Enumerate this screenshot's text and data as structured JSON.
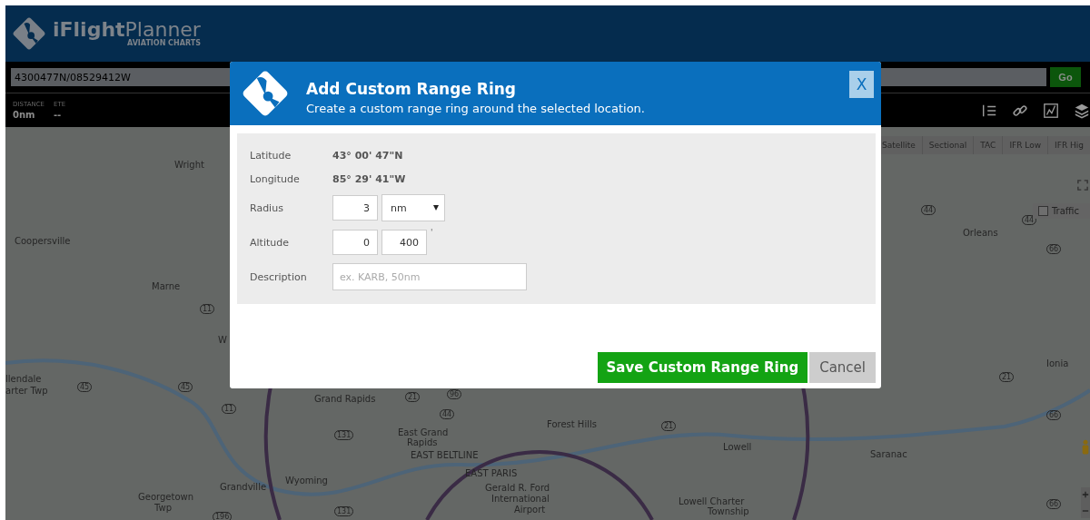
{
  "header": {
    "brand": "iFlight",
    "brand_light": "Planner",
    "tagline": "AVIATION CHARTS"
  },
  "search": {
    "value": "4300477N/08529412W",
    "button": "Go"
  },
  "stats": [
    {
      "label": "DISTANCE",
      "value": "0nm"
    },
    {
      "label": "ETE",
      "value": "--"
    }
  ],
  "map_types": [
    {
      "label": "Satellite",
      "selected": false
    },
    {
      "label": "Sectional",
      "selected": false
    },
    {
      "label": "TAC",
      "selected": false
    },
    {
      "label": "IFR Low",
      "selected": false
    },
    {
      "label": "IFR Hig",
      "selected": false
    }
  ],
  "traffic": {
    "label": "Traffic",
    "checked": false
  },
  "map_labels": [
    "Wright",
    "Coopersville",
    "Marne",
    "W",
    "llendale",
    "arter Twp",
    "Georgetown",
    "Twp",
    "Grandville",
    "Grand Rapids",
    "East Grand",
    "Rapids",
    "EAST BELTLINE",
    "EAST PARIS",
    "Wyoming",
    "Gerald R. Ford",
    "International",
    "Airport",
    "Forest Hills",
    "Lowell",
    "Lowell Charter",
    "Township",
    "Saranac",
    "Orleans",
    "Ionia"
  ],
  "road_shields": [
    "11",
    "45",
    "45",
    "11",
    "131",
    "131",
    "196",
    "96",
    "44",
    "21",
    "21",
    "21",
    "44",
    "44",
    "66",
    "66",
    "66"
  ],
  "dialog": {
    "title": "Add Custom Range Ring",
    "subtitle": "Create a custom range ring around the selected location.",
    "close": "X",
    "info": [
      {
        "label": "Latitude",
        "value": "43° 00' 47\"N"
      },
      {
        "label": "Longitude",
        "value": "85° 29' 41\"W"
      }
    ],
    "radius": {
      "label": "Radius",
      "value": "3",
      "unit": "nm"
    },
    "altitude": {
      "label": "Altitude",
      "min": "0",
      "max": "400",
      "unit": "'"
    },
    "description": {
      "label": "Description",
      "placeholder": "ex. KARB, 50nm"
    },
    "save": "Save Custom Range Ring",
    "cancel": "Cancel"
  }
}
